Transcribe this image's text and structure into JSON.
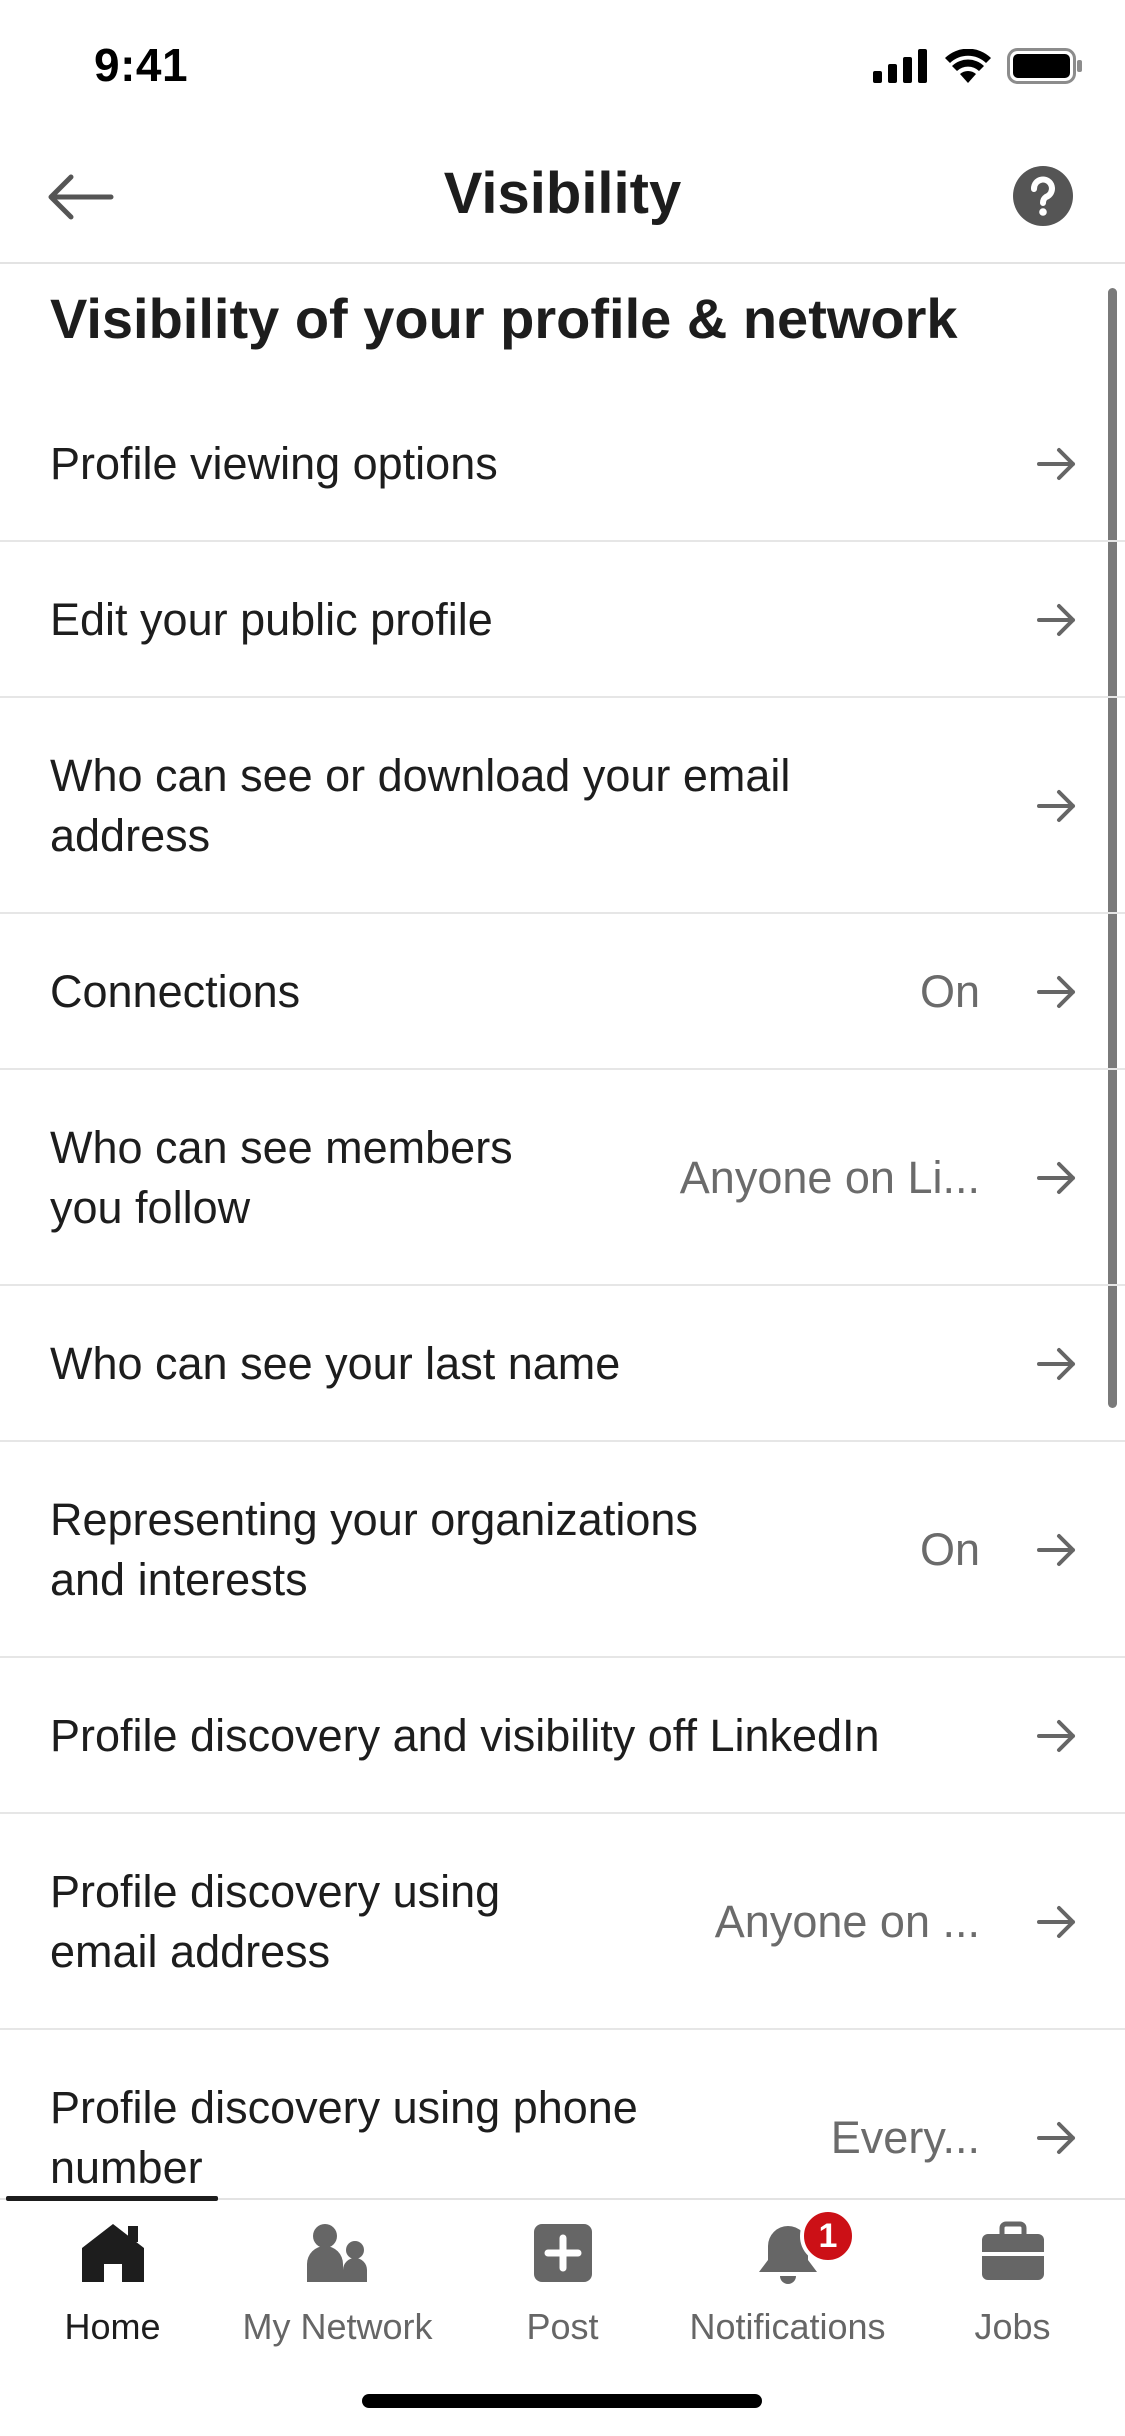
{
  "status_bar": {
    "time": "9:41"
  },
  "header": {
    "title": "Visibility",
    "back_icon": "arrow-left-icon",
    "help_icon": "question-circle-icon"
  },
  "section": {
    "title": "Visibility of your profile & network"
  },
  "rows": [
    {
      "label_lines": [
        "Profile viewing options"
      ],
      "value": ""
    },
    {
      "label_lines": [
        "Edit your public profile"
      ],
      "value": ""
    },
    {
      "label_lines": [
        "Who can see or download your email",
        "address"
      ],
      "value": ""
    },
    {
      "label_lines": [
        "Connections"
      ],
      "value": "On"
    },
    {
      "label_lines": [
        "Who can see members",
        "you follow"
      ],
      "value": "Anyone on Li..."
    },
    {
      "label_lines": [
        "Who can see your last name"
      ],
      "value": ""
    },
    {
      "label_lines": [
        "Representing your organizations",
        "and interests"
      ],
      "value": "On"
    },
    {
      "label_lines": [
        "Profile discovery and visibility off LinkedIn"
      ],
      "value": ""
    },
    {
      "label_lines": [
        "Profile discovery using",
        "email address"
      ],
      "value": "Anyone on ..."
    },
    {
      "label_lines": [
        "Profile discovery using phone",
        "number"
      ],
      "value": "Every..."
    }
  ],
  "bottom_nav": {
    "items": [
      {
        "label": "Home",
        "icon": "home-icon",
        "active": true
      },
      {
        "label": "My Network",
        "icon": "people-icon",
        "active": false
      },
      {
        "label": "Post",
        "icon": "plus-square-icon",
        "active": false
      },
      {
        "label": "Notifications",
        "icon": "bell-icon",
        "active": false,
        "badge": "1"
      },
      {
        "label": "Jobs",
        "icon": "briefcase-icon",
        "active": false
      }
    ]
  },
  "colors": {
    "text_primary": "#1d1d1d",
    "text_secondary": "#6b6b6b",
    "icon_gray": "#666666",
    "divider": "#e6e6e6",
    "badge_red": "#cc1016"
  }
}
